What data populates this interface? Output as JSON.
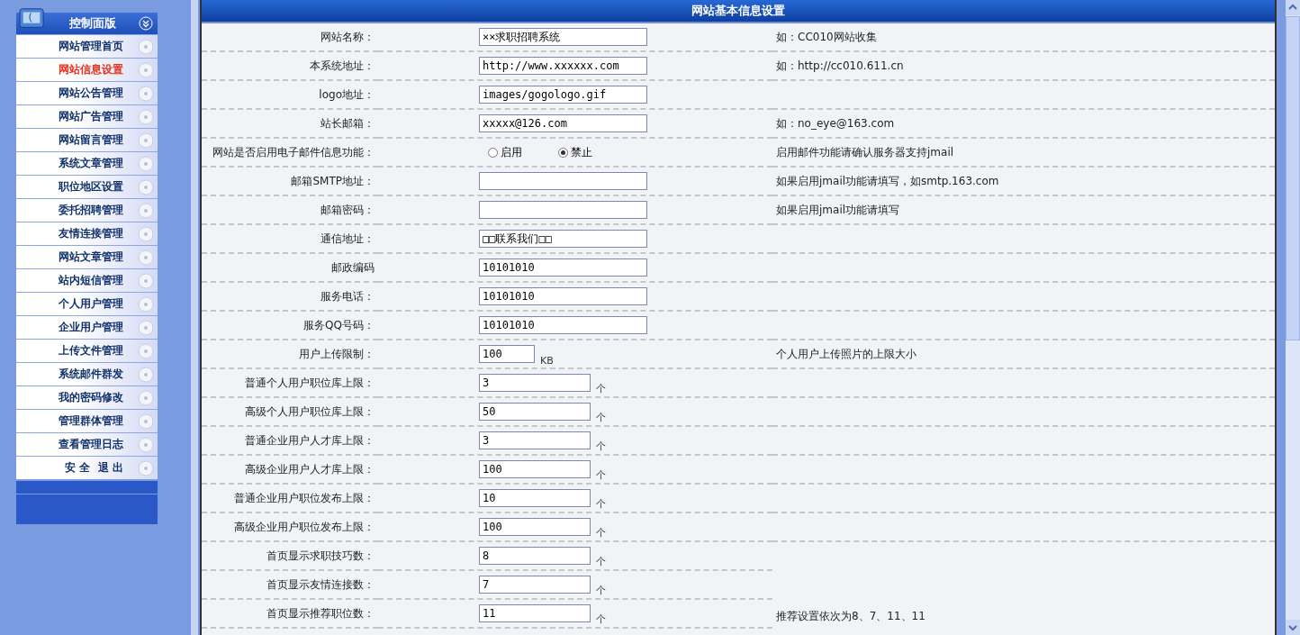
{
  "sidebar": {
    "title": "控制面版",
    "items": [
      {
        "label": "网站管理首页",
        "selected": false
      },
      {
        "label": "网站信息设置",
        "selected": true
      },
      {
        "label": "网站公告管理",
        "selected": false
      },
      {
        "label": "网站广告管理",
        "selected": false
      },
      {
        "label": "网站留言管理",
        "selected": false
      },
      {
        "label": "系统文章管理",
        "selected": false
      },
      {
        "label": "职位地区设置",
        "selected": false
      },
      {
        "label": "委托招聘管理",
        "selected": false
      },
      {
        "label": "友情连接管理",
        "selected": false
      },
      {
        "label": "网站文章管理",
        "selected": false
      },
      {
        "label": "站内短信管理",
        "selected": false
      },
      {
        "label": "个人用户管理",
        "selected": false
      },
      {
        "label": "企业用户管理",
        "selected": false
      },
      {
        "label": "上传文件管理",
        "selected": false
      },
      {
        "label": "系统邮件群发",
        "selected": false
      },
      {
        "label": "我的密码修改",
        "selected": false
      },
      {
        "label": "管理群体管理",
        "selected": false
      },
      {
        "label": "查看管理日志",
        "selected": false
      },
      {
        "label": "安 全  退 出",
        "selected": false
      }
    ]
  },
  "panel": {
    "title": "网站基本信息设置",
    "rows": [
      {
        "label": "网站名称：",
        "kind": "text",
        "value": "××求职招聘系统",
        "hint": "如：CC010网站收集"
      },
      {
        "label": "本系统地址：",
        "kind": "text",
        "value": "http://www.xxxxxx.com",
        "hint": "如：http://cc010.611.cn"
      },
      {
        "label": "logo地址：",
        "kind": "text",
        "value": "images/gogologo.gif"
      },
      {
        "label": "站长邮箱：",
        "kind": "text",
        "value": "xxxxx@126.com",
        "hint": "如：no_eye@163.com"
      },
      {
        "label": "网站是否启用电子邮件信息功能：",
        "kind": "radio",
        "options": [
          {
            "label": "启用",
            "selected": false
          },
          {
            "label": "禁止",
            "selected": true
          }
        ],
        "hint": "启用邮件功能请确认服务器支持jmail"
      },
      {
        "label": "邮箱SMTP地址：",
        "kind": "text",
        "hint": "如果启用jmail功能请填写，如smtp.163.com"
      },
      {
        "label": "邮箱密码：",
        "kind": "text",
        "hint": "如果启用jmail功能请填写"
      },
      {
        "label": "通信地址：",
        "kind": "text",
        "value": "□□联系我们□□"
      },
      {
        "label": "邮政编码",
        "kind": "text",
        "value": "10101010"
      },
      {
        "label": "服务电话：",
        "kind": "text",
        "value": "10101010"
      },
      {
        "label": "服务QQ号码：",
        "kind": "text",
        "value": "10101010"
      },
      {
        "label": "用户上传限制：",
        "kind": "small",
        "value": "100",
        "unit": "KB",
        "hint": "个人用户上传照片的上限大小"
      },
      {
        "label": "普通个人用户职位库上限：",
        "kind": "number",
        "value": "3",
        "unit": "个"
      },
      {
        "label": "高级个人用户职位库上限：",
        "kind": "number",
        "value": "50",
        "unit": "个"
      },
      {
        "label": "普通企业用户人才库上限：",
        "kind": "number",
        "value": "3",
        "unit": "个"
      },
      {
        "label": "高级企业用户人才库上限：",
        "kind": "number",
        "value": "100",
        "unit": "个"
      },
      {
        "label": "普通企业用户职位发布上限：",
        "kind": "number",
        "value": "10",
        "unit": "个"
      },
      {
        "label": "高级企业用户职位发布上限：",
        "kind": "number",
        "value": "100",
        "unit": "个"
      }
    ],
    "homepage_group": {
      "hint": "推荐设置依次为8、7、11、11",
      "rows": [
        {
          "label": "首页显示求职技巧数：",
          "kind": "number",
          "value": "8",
          "unit": "个"
        },
        {
          "label": "首页显示友情连接数：",
          "kind": "number",
          "value": "7",
          "unit": "个"
        },
        {
          "label": "首页显示推荐职位数：",
          "kind": "number",
          "value": "11",
          "unit": "个"
        }
      ]
    }
  }
}
